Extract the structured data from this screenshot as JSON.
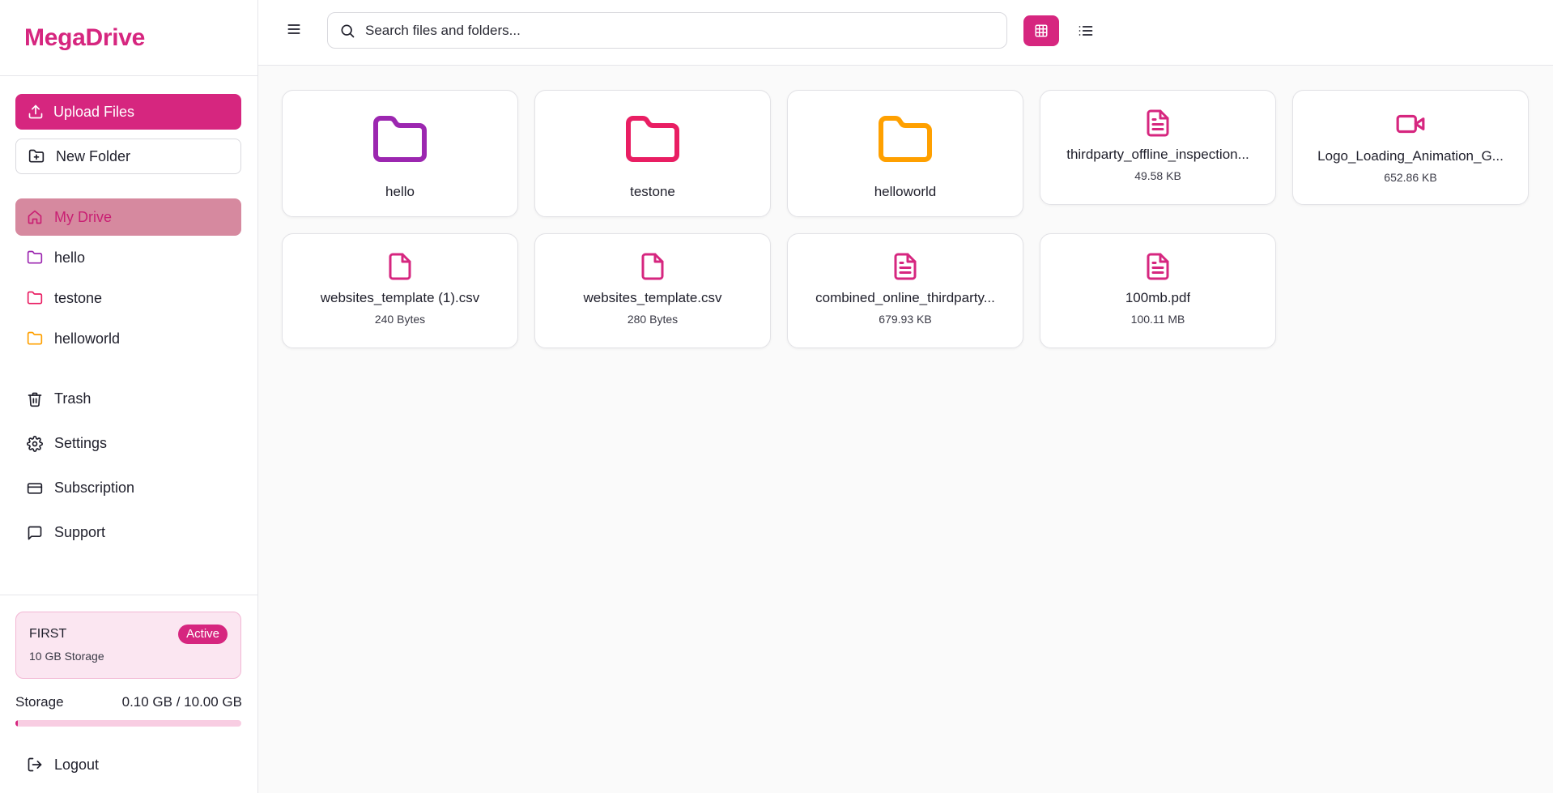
{
  "app": {
    "title": "MegaDrive",
    "accent": "#d6267f"
  },
  "sidebar": {
    "upload_label": "Upload Files",
    "new_folder_label": "New Folder",
    "nav": [
      {
        "label": "My Drive",
        "icon": "home-icon",
        "active": true
      },
      {
        "label": "hello",
        "icon": "folder-icon",
        "color": "#9c27b0"
      },
      {
        "label": "testone",
        "icon": "folder-icon",
        "color": "#e91e63"
      },
      {
        "label": "helloworld",
        "icon": "folder-icon",
        "color": "#ffa000"
      }
    ],
    "lower_nav": [
      {
        "label": "Trash",
        "icon": "trash-icon"
      },
      {
        "label": "Settings",
        "icon": "gear-icon"
      },
      {
        "label": "Subscription",
        "icon": "credit-card-icon"
      },
      {
        "label": "Support",
        "icon": "chat-icon"
      }
    ],
    "plan": {
      "name": "FIRST",
      "storage": "10 GB Storage",
      "status": "Active"
    },
    "storage": {
      "label": "Storage",
      "usage": "0.10 GB / 10.00 GB",
      "fraction": 0.01
    },
    "logout_label": "Logout"
  },
  "header": {
    "search_placeholder": "Search files and folders...",
    "view_mode": "grid"
  },
  "items": [
    {
      "type": "folder",
      "name": "hello",
      "color": "#9c27b0"
    },
    {
      "type": "folder",
      "name": "testone",
      "color": "#e91e63"
    },
    {
      "type": "folder",
      "name": "helloworld",
      "color": "#ffa000"
    },
    {
      "type": "file",
      "name": "thirdparty_offline_inspection...",
      "size": "49.58 KB",
      "icon": "document-icon"
    },
    {
      "type": "file",
      "name": "Logo_Loading_Animation_G...",
      "size": "652.86 KB",
      "icon": "video-icon"
    },
    {
      "type": "file",
      "name": "websites_template (1).csv",
      "size": "240 Bytes",
      "icon": "file-icon"
    },
    {
      "type": "file",
      "name": "websites_template.csv",
      "size": "280 Bytes",
      "icon": "file-icon"
    },
    {
      "type": "file",
      "name": "combined_online_thirdparty...",
      "size": "679.93 KB",
      "icon": "document-icon"
    },
    {
      "type": "file",
      "name": "100mb.pdf",
      "size": "100.11 MB",
      "icon": "document-icon"
    }
  ]
}
